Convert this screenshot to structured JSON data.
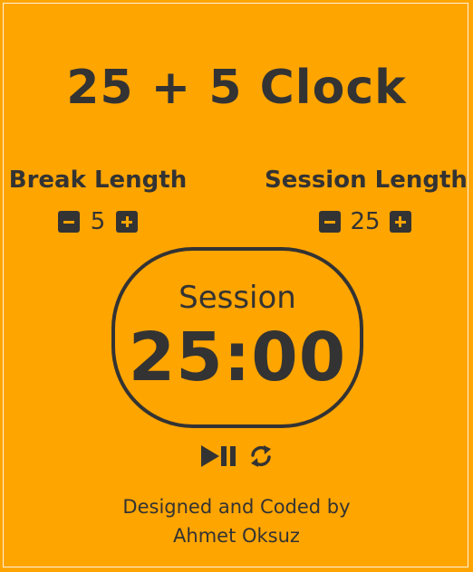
{
  "app": {
    "title": "25 + 5 Clock"
  },
  "break": {
    "label": "Break Length",
    "value": "5"
  },
  "session": {
    "label": "Session Length",
    "value": "25"
  },
  "timer": {
    "label": "Session",
    "time": "25:00"
  },
  "controls": {
    "play_pause_icon": "play-pause-icon",
    "reset_icon": "refresh-icon"
  },
  "footer": {
    "line1": "Designed and Coded by",
    "line2": "Ahmet Oksuz"
  },
  "colors": {
    "background": "#ffa500",
    "foreground": "#333333",
    "frame_border": "#fff3dc"
  }
}
